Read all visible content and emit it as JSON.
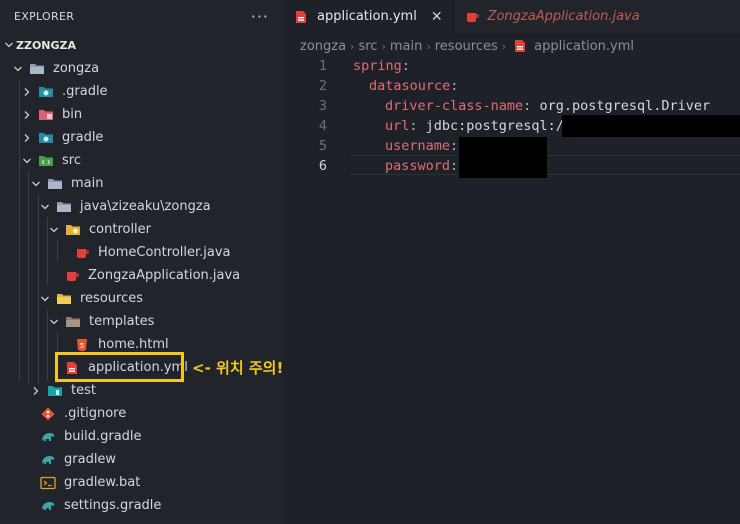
{
  "explorer": {
    "title": "EXPLORER",
    "more": "···",
    "root": "ZZONGZA",
    "items": [
      {
        "label": "zongza"
      },
      {
        "label": ".gradle"
      },
      {
        "label": "bin"
      },
      {
        "label": "gradle"
      },
      {
        "label": "src"
      },
      {
        "label": "main"
      },
      {
        "label": "java\\zizeaku\\zongza"
      },
      {
        "label": "controller"
      },
      {
        "label": "HomeController.java"
      },
      {
        "label": "ZongzaApplication.java"
      },
      {
        "label": "resources"
      },
      {
        "label": "templates"
      },
      {
        "label": "home.html"
      },
      {
        "label": "application.yml"
      },
      {
        "label": "test"
      },
      {
        "label": ".gitignore"
      },
      {
        "label": "build.gradle"
      },
      {
        "label": "gradlew"
      },
      {
        "label": "gradlew.bat"
      },
      {
        "label": "settings.gradle"
      }
    ],
    "annotation": "<- 위치 주의!"
  },
  "tabs": [
    {
      "label": "application.yml",
      "close": "✕"
    },
    {
      "label": "ZongzaApplication.java"
    }
  ],
  "breadcrumb": [
    "zongza",
    "src",
    "main",
    "resources",
    "application.yml"
  ],
  "code": [
    {
      "num": "1",
      "key": "spring",
      "colon": ":",
      "value": ""
    },
    {
      "num": "2",
      "key": "datasource",
      "colon": ":",
      "value": ""
    },
    {
      "num": "3",
      "key": "driver-class-name",
      "colon": ":",
      "value": " org.postgresql.Driver"
    },
    {
      "num": "4",
      "key": "url",
      "colon": ":",
      "value": " jdbc:postgresql:/"
    },
    {
      "num": "5",
      "key": "username",
      "colon": ":",
      "value": ""
    },
    {
      "num": "6",
      "key": "password",
      "colon": ":",
      "value": ""
    }
  ],
  "colors": {
    "accent_annotation": "#f2c81f",
    "yaml_key": "#e06c75",
    "sidebar_bg": "#21252b",
    "editor_bg": "#1e2128"
  }
}
